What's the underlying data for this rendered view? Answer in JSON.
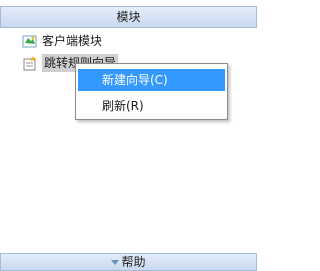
{
  "header": {
    "title": "模块"
  },
  "tree": {
    "items": [
      {
        "label": "客户端模块",
        "icon": "module-icon"
      },
      {
        "label": "跳转规则向导",
        "icon": "wizard-icon",
        "selected": true
      }
    ]
  },
  "context_menu": {
    "items": [
      {
        "label": "新建向导(C)",
        "highlighted": true
      },
      {
        "label": "刷新(R)"
      }
    ]
  },
  "footer": {
    "label": "帮助",
    "icon": "triangle-down-icon"
  },
  "colors": {
    "highlight": "#3399ff",
    "header_gradient_top": "#e3edf9",
    "header_gradient_bottom": "#c8d9ef",
    "selected_item_bg": "#d0d0d0"
  }
}
